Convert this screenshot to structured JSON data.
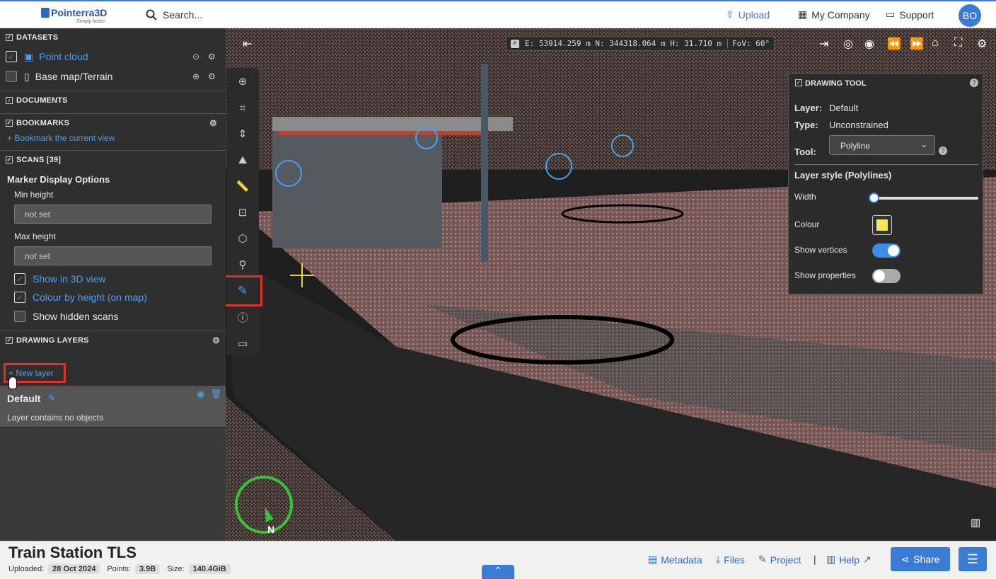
{
  "app": {
    "brand": "Pointerra3D",
    "tagline": "Simply faster."
  },
  "topbar": {
    "search": "Search...",
    "upload": "Upload",
    "company": "My Company",
    "support": "Support",
    "avatar": "BO"
  },
  "sidebar": {
    "datasets": {
      "title": "DATASETS",
      "items": [
        {
          "label": "Point cloud",
          "checked": true
        },
        {
          "label": "Base map/Terrain",
          "checked": false
        }
      ]
    },
    "documents": {
      "title": "DOCUMENTS"
    },
    "bookmarks": {
      "title": "BOOKMARKS",
      "add": "+ Bookmark the current view"
    },
    "scans": {
      "title": "SCANS [39]",
      "options_title": "Marker Display Options",
      "min_label": "Min height",
      "min_value": "not set",
      "max_label": "Max height",
      "max_value": "not set",
      "show3d": "Show in 3D view",
      "colour_by_height": "Colour by height (on map)",
      "show_hidden": "Show hidden scans"
    },
    "drawing_layers": {
      "title": "DRAWING LAYERS",
      "new_layer": "+ New layer",
      "layer_name": "Default",
      "layer_desc": "Layer contains no objects"
    }
  },
  "coords": {
    "text": "E: 53914.259 m N: 344318.064 m H: 31.710 m",
    "fov": "FoV: 60°"
  },
  "drawtool": {
    "title": "DRAWING TOOL",
    "layer_label": "Layer:",
    "layer_value": "Default",
    "type_label": "Type:",
    "type_value": "Unconstrained",
    "tool_label": "Tool:",
    "tool_value": "Polyline",
    "style_title": "Layer style (Polylines)",
    "width_label": "Width",
    "width_level": 0.0,
    "colour_label": "Colour",
    "colour": "#f5e65a",
    "vertices_label": "Show vertices",
    "vertices_on": true,
    "properties_label": "Show properties",
    "properties_on": false
  },
  "compass": {
    "north": "N"
  },
  "footer": {
    "title": "Train Station TLS",
    "uploaded_label": "Uploaded:",
    "uploaded": "28 Oct 2024",
    "points_label": "Points:",
    "points": "3.9B",
    "size_label": "Size:",
    "size": "140.4GiB",
    "metadata": "Metadata",
    "files": "Files",
    "project": "Project",
    "sep": "|",
    "help": "Help",
    "share": "Share"
  },
  "colors": {
    "accent": "#3a7bd5",
    "highlight": "#e0302a"
  }
}
